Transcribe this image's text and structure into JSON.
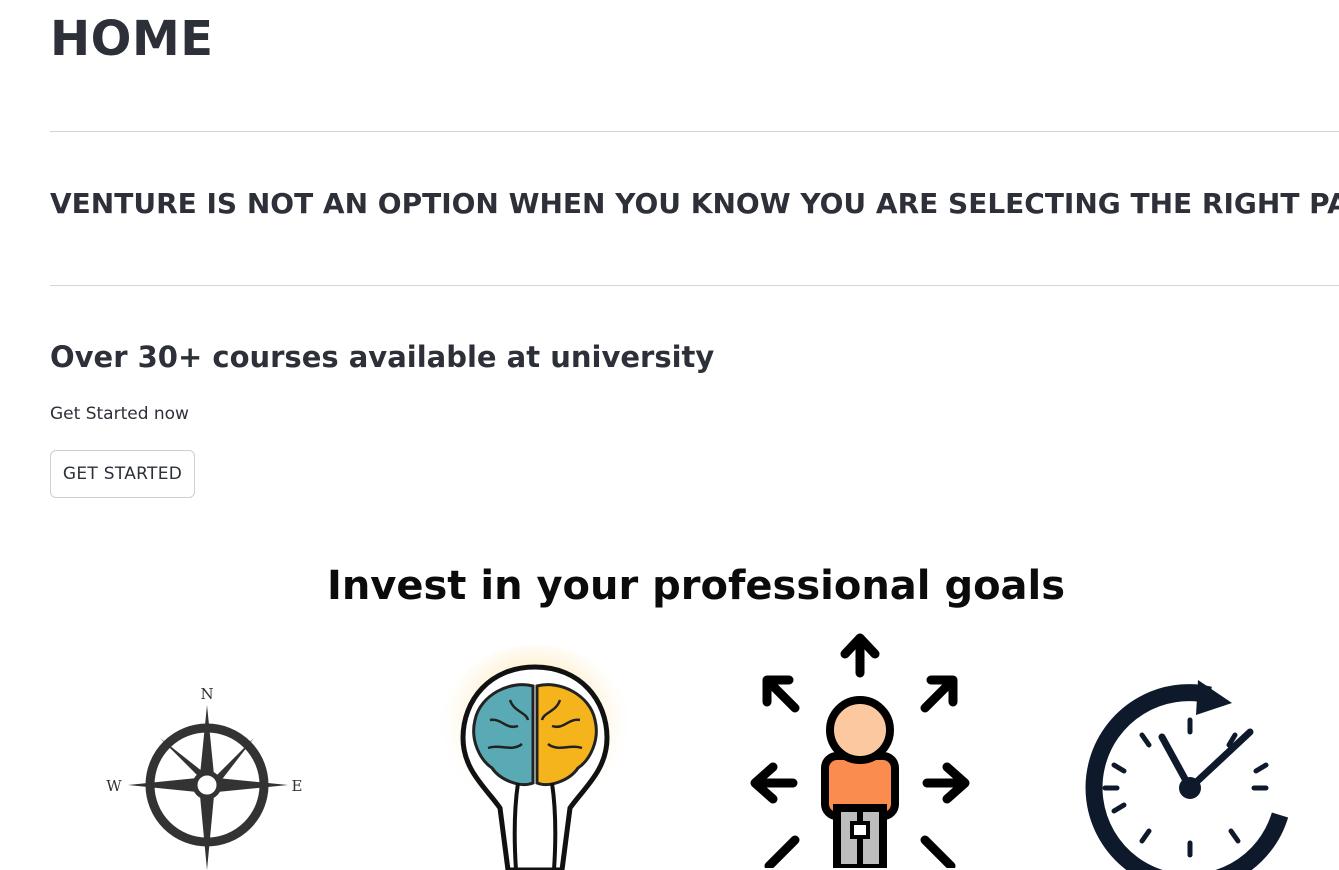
{
  "page": {
    "title": "HOME",
    "tagline": "VENTURE IS NOT AN OPTION WHEN YOU KNOW YOU ARE SELECTING THE RIGHT PATH",
    "courses_heading": "Over 30+ courses available at university",
    "subtext": "Get Started now",
    "cta_label": "GET STARTED",
    "section_heading": "Invest in your professional goals"
  },
  "features": {
    "icons": [
      "compass-icon",
      "lightbulb-brain-icon",
      "person-directions-icon",
      "clock-icon"
    ],
    "compass_letters": {
      "n": "N",
      "w": "W",
      "e": "E"
    }
  },
  "colors": {
    "text": "#2d3039",
    "divider": "#d5d5d5",
    "brain_teal": "#5aaab5",
    "brain_yellow": "#f6b41c",
    "person_orange": "#fb8c4f",
    "person_skin": "#fcc8a0",
    "clock_navy": "#0e1a2b"
  }
}
